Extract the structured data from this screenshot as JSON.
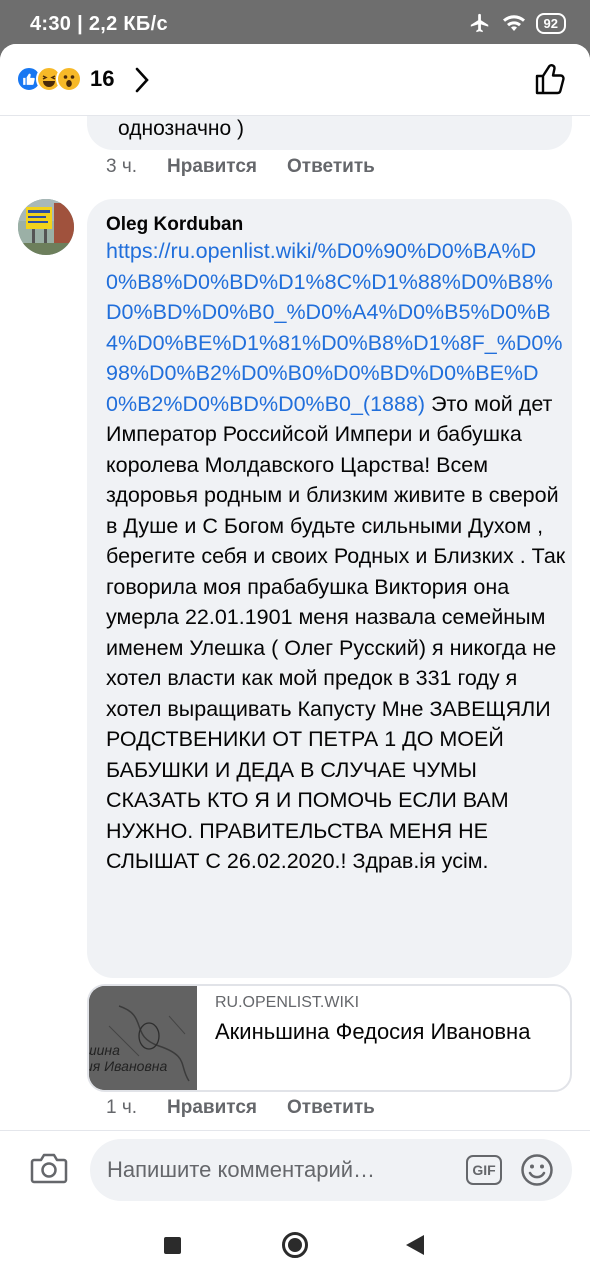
{
  "status_bar": {
    "time": "4:30",
    "network_speed": "2,2 КБ/с",
    "battery": "92"
  },
  "reactions": {
    "count": "16",
    "types": [
      "like",
      "haha",
      "wow"
    ]
  },
  "previous_comment": {
    "text_tail": "однозначно )",
    "timestamp": "3 ч.",
    "like_label": "Нравится",
    "reply_label": "Ответить"
  },
  "comment": {
    "author": "Oleg Korduban",
    "link_text": "https://ru.openlist.wiki/%D0%90%D0%BA%D0%B8%D0%BD%D1%8C%D1%88%D0%B8%D0%BD%D0%B0_%D0%A4%D0%B5%D0%B4%D0%BE%D1%81%D0%B8%D1%8F_%D0%98%D0%B2%D0%B0%D0%BD%D0%BE%D0%B2%D0%BD%D0%B0_(1888)",
    "text": "Это мой дет Император Российсой Импери  и бабушка королева Молдавского Царства! Всем здоровья родным и близким живите в сверой в Душе и С Богом будьте сильными Духом , берегите себя и своих Родных и Близких . Так говорила моя прабабушка Виктория она умерла 22.01.1901 меня назвала семейным именем Улешка ( Олег Русский) я никогда не хотел власти как мой предок в 331 году я хотел выращивать Капусту Мне ЗАВЕЩЯЛИ РОДСТВЕНИКИ ОТ ПЕТРА 1 ДО МОЕЙ БАБУШКИ И ДЕДА В СЛУЧАЕ ЧУМЫ СКАЗАТЬ КТО Я И ПОМОЧЬ ЕСЛИ ВАМ НУЖНО. ПРАВИТЕЛЬСТВА МЕНЯ НЕ СЛЫШАТ С 26.02.2020.! Здрав.ія усім.",
    "link_preview": {
      "domain": "RU.OPENLIST.WIKI",
      "title": "Акиньшина Федосия Ивановна",
      "thumb_caption": "шина\nия Ивановна"
    },
    "timestamp": "1 ч.",
    "like_label": "Нравится",
    "reply_label": "Ответить"
  },
  "composer": {
    "placeholder": "Напишите комментарий…",
    "gif_label": "GIF"
  },
  "colors": {
    "link": "#216fdb",
    "like_blue": "#1877f2",
    "bubble_bg": "#f0f2f5",
    "meta_gray": "#65676b"
  }
}
